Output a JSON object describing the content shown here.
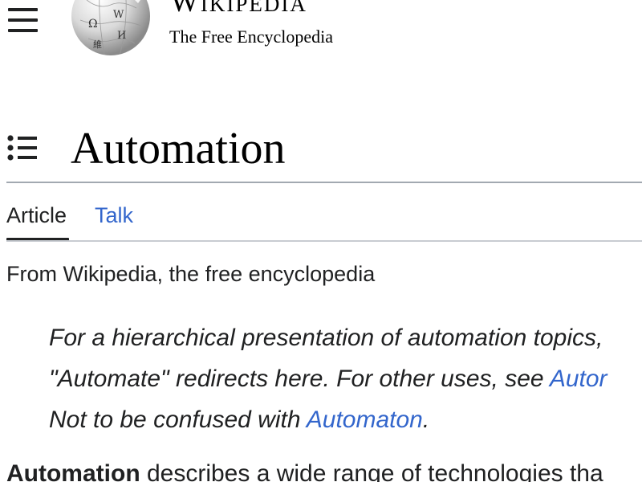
{
  "header": {
    "menu_icon": "hamburger-menu-icon",
    "logo_icon": "wikipedia-globe-logo",
    "wordmark": "Wikipedia",
    "tagline": "The Free Encyclopedia"
  },
  "article": {
    "toc_icon": "table-of-contents-icon",
    "title": "Automation",
    "tabs": [
      {
        "label": "Article",
        "active": true
      },
      {
        "label": "Talk",
        "active": false
      }
    ],
    "from_line": "From Wikipedia, the free encyclopedia",
    "hatnotes": [
      {
        "text": "For a hierarchical presentation of automation topics,",
        "link": "",
        "suffix": ""
      },
      {
        "text": "\"Automate\" redirects here. For other uses, see ",
        "link": "Autor",
        "suffix": ""
      },
      {
        "text": "Not to be confused with ",
        "link": "Automaton",
        "suffix": "."
      }
    ],
    "lead": {
      "bold": "Automation",
      "text": " describes a wide range of technologies tha"
    }
  },
  "colors": {
    "text": "#202122",
    "link": "#3366cc",
    "rule": "#a2a9b1"
  }
}
